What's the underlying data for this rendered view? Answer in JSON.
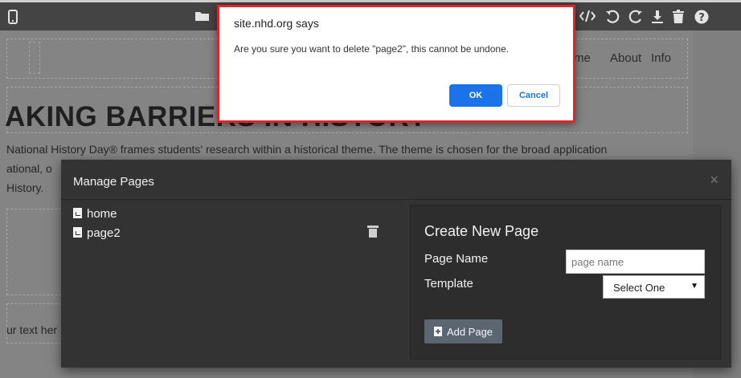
{
  "toolbar": {
    "left_icons": [
      "mobile-device-icon",
      "folder-icon"
    ],
    "right_icons": [
      "code-icon",
      "undo-icon",
      "redo-icon",
      "download-icon",
      "trash-icon",
      "help-icon"
    ]
  },
  "canvas": {
    "nav_links": [
      "me",
      "About",
      "Info"
    ],
    "hero_title": "AKING BARRIERS IN HISTORY",
    "body_line1": "National History Day® frames students' research within a historical theme. The theme is chosen for the broad application",
    "body_line2": "ational, o",
    "body_line3": "History.",
    "placeholder_text": "ur text her"
  },
  "alert": {
    "title": "site.nhd.org says",
    "message": "Are you sure you want to delete \"page2\", this cannot be undone.",
    "ok_label": "OK",
    "cancel_label": "Cancel",
    "ok_color": "#1a73e8",
    "highlight_color": "#e0242c"
  },
  "modal": {
    "title": "Manage Pages",
    "close_label": "×",
    "pages": [
      {
        "name": "home",
        "icon": "file-code-icon"
      },
      {
        "name": "page2",
        "icon": "file-code-icon"
      }
    ],
    "create": {
      "heading": "Create New Page",
      "page_name_label": "Page Name",
      "page_name_placeholder": "page name",
      "page_name_value": "",
      "template_label": "Template",
      "template_selected": "Select One",
      "add_button_label": "Add Page"
    }
  }
}
